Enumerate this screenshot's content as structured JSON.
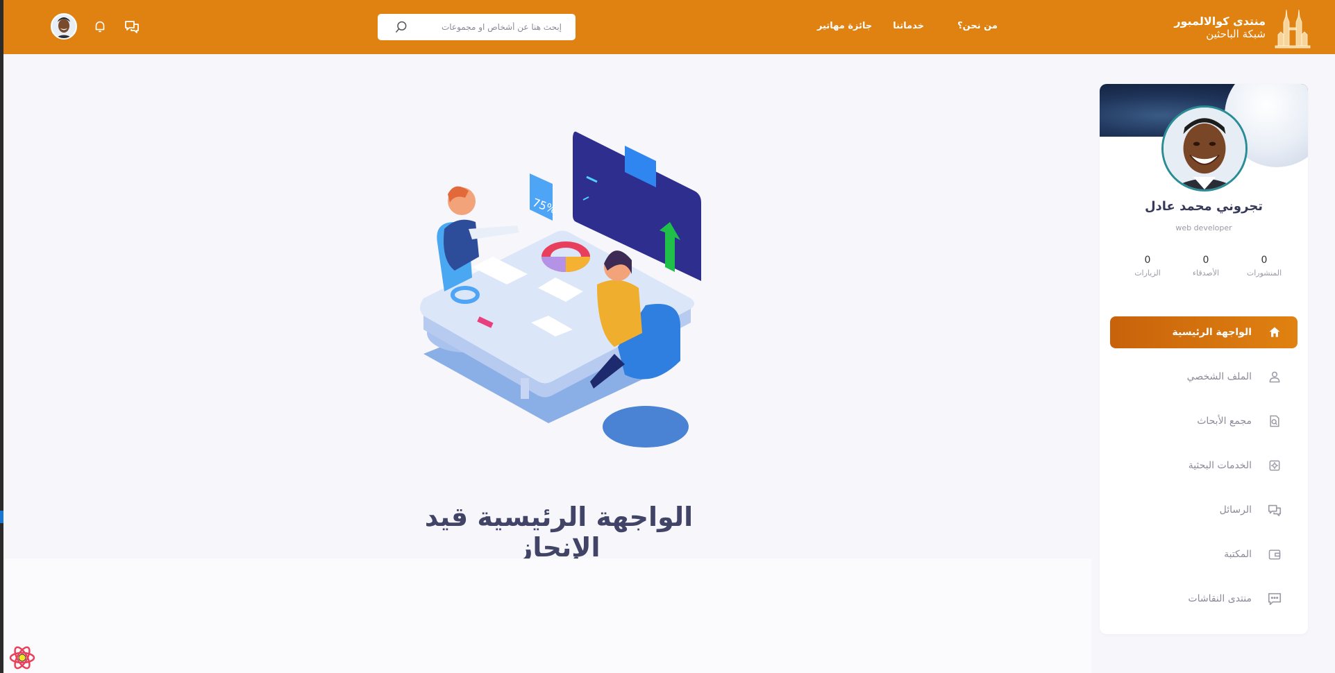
{
  "brand": {
    "title": "منتدى كوالالمبور",
    "subtitle": "شبكة الباحثين"
  },
  "nav": {
    "items": [
      {
        "label": "من نحن؟"
      },
      {
        "label": "خدماتنا"
      },
      {
        "label": "جائزة مهاتير"
      }
    ]
  },
  "search": {
    "placeholder": "إبحث هنا عن أشخاص او مجموعات"
  },
  "header_icons": [
    "avatar",
    "bell-icon",
    "chat-icon"
  ],
  "main": {
    "title": "الواجهة الرئيسية قيد الإنجاز",
    "illustration_badge": "75%"
  },
  "profile": {
    "name": "تجروني محمد عادل",
    "role": "web developer",
    "stats": [
      {
        "value": "0",
        "label": "المنشورات"
      },
      {
        "value": "0",
        "label": "الأصدقاء"
      },
      {
        "value": "0",
        "label": "الزيارات"
      }
    ]
  },
  "menu": {
    "items": [
      {
        "label": "الواجهة الرئيسية",
        "icon": "home-icon",
        "active": true
      },
      {
        "label": "الملف الشخصي",
        "icon": "user-icon"
      },
      {
        "label": "مجمع الأبحاث",
        "icon": "document-search-icon"
      },
      {
        "label": "الخدمات البحثية",
        "icon": "settings-icon"
      },
      {
        "label": "الرسائل",
        "icon": "messages-icon"
      },
      {
        "label": "المكتبة",
        "icon": "wallet-icon"
      },
      {
        "label": "منتدى النقاشات",
        "icon": "comment-icon"
      }
    ]
  },
  "colors": {
    "header": "#e08211",
    "accent_dark": "#c8620b",
    "background": "#f7f7fb",
    "title_text": "#414467"
  }
}
